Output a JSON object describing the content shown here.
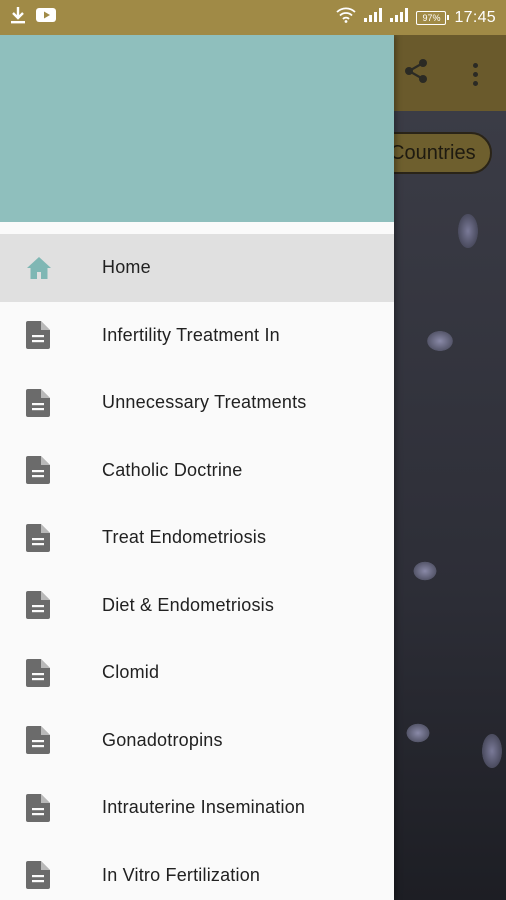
{
  "status_bar": {
    "left_icons": [
      "download-icon",
      "youtube-icon"
    ],
    "right_icons": [
      "wifi-icon",
      "signal-icon",
      "signal-icon",
      "battery-icon"
    ],
    "battery": "97%",
    "time": "17:45"
  },
  "toolbar": {
    "icons": [
      "share-icon",
      "more-vert-icon"
    ]
  },
  "chip": {
    "label": "Countries"
  },
  "drawer": {
    "items": [
      {
        "label": "Home",
        "icon": "home-icon",
        "selected": true
      },
      {
        "label": "Infertility Treatment In",
        "icon": "document-icon"
      },
      {
        "label": "Unnecessary Treatments",
        "icon": "document-icon"
      },
      {
        "label": "Catholic Doctrine",
        "icon": "document-icon"
      },
      {
        "label": "Treat Endometriosis",
        "icon": "document-icon"
      },
      {
        "label": "Diet & Endometriosis",
        "icon": "document-icon"
      },
      {
        "label": "Clomid",
        "icon": "document-icon"
      },
      {
        "label": "Gonadotropins",
        "icon": "document-icon"
      },
      {
        "label": "Intrauterine Insemination",
        "icon": "document-icon"
      },
      {
        "label": "In Vitro Fertilization",
        "icon": "document-icon"
      }
    ]
  },
  "colors": {
    "status_bar": "#a08a46",
    "drawer_header": "#8fbfbd",
    "home_icon": "#7fb7b4",
    "document_icon": "#6b6b6b",
    "selected_row": "#e0e0e0"
  }
}
